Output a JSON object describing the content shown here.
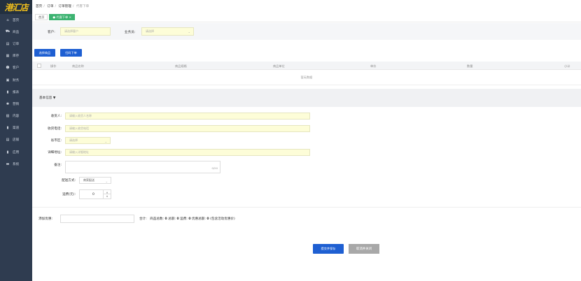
{
  "logo_text": "港汇店",
  "sidebar": {
    "items": [
      {
        "label": "首页",
        "icon": "home-icon",
        "glyph": "⌂"
      },
      {
        "label": "商品",
        "icon": "cart-icon",
        "glyph": "⛟"
      },
      {
        "label": "订单",
        "icon": "doc-icon",
        "glyph": "▤"
      },
      {
        "label": "库存",
        "icon": "grid-icon",
        "glyph": "▦"
      },
      {
        "label": "客户",
        "icon": "user-icon",
        "glyph": "☻"
      },
      {
        "label": "财务",
        "icon": "money-icon",
        "glyph": "▣"
      },
      {
        "label": "报表",
        "icon": "chart-icon",
        "glyph": "▮"
      },
      {
        "label": "营销",
        "icon": "gear-icon",
        "glyph": "✺"
      },
      {
        "label": "内容",
        "icon": "image-icon",
        "glyph": "▧"
      },
      {
        "label": "渠道",
        "icon": "bars-icon",
        "glyph": "▮"
      },
      {
        "label": "店铺",
        "icon": "file-icon",
        "glyph": "▤"
      },
      {
        "label": "应用",
        "icon": "bars-icon",
        "glyph": "▮"
      },
      {
        "label": "系统",
        "icon": "card-icon",
        "glyph": "▬"
      }
    ]
  },
  "breadcrumb": {
    "home": "首页",
    "orders": "订单",
    "order_mgmt": "订单管理",
    "current": "代客下单"
  },
  "tabs": {
    "home": "首页",
    "active": "● 代客下单 ×"
  },
  "filter": {
    "customer_label": "客户:",
    "customer_placeholder": "请选择客户",
    "salesman_label": "业务员:",
    "salesman_placeholder": "请选择"
  },
  "buttons": {
    "select_goods": "选择商品",
    "scan_order": "扫码下单",
    "submit_save": "提交并保存",
    "cancel_close": "取消并关闭"
  },
  "table": {
    "headers": [
      "操作",
      "商品名称",
      "商品规格",
      "商品单位",
      "单价",
      "数量",
      "小计"
    ],
    "empty_text": "暂无数据"
  },
  "basic_info": {
    "title": "基本信息 ▼",
    "receiver_label": "收货人:",
    "receiver_placeholder": "请输入收货人名称",
    "phone_label": "收货电话:",
    "phone_placeholder": "请输入收货电话",
    "region_label": "省市区:",
    "region_placeholder": "请选择",
    "address_label": "详细地址:",
    "address_placeholder": "请输入详细地址",
    "remark_label": "备注:",
    "remark_count": "0/50",
    "delivery_label": "配送方式:",
    "delivery_value": "商家配送",
    "freight_label": "运费(元):",
    "freight_value": "0"
  },
  "footer": {
    "coupon_label": "添加优惠:",
    "total_label": "合计:",
    "goods_total_label": "商品总数:",
    "goods_total": "0",
    "amount_label": "总额:",
    "amount": "0",
    "freight_label": "运费:",
    "freight": "0",
    "discount_label": "优惠总额:",
    "discount": "0",
    "note": "(包含活动优惠价)"
  }
}
